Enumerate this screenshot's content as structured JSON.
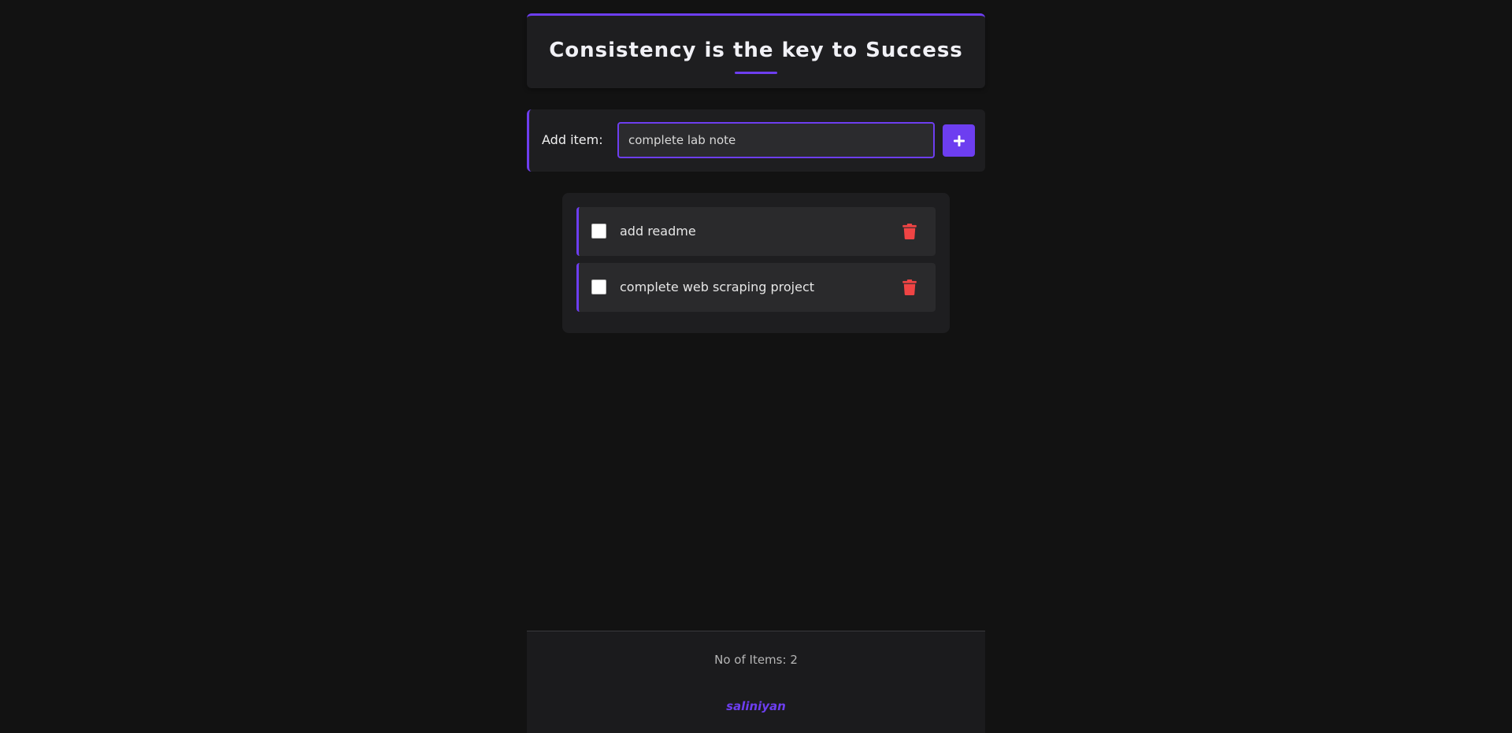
{
  "colors": {
    "background": "#121212",
    "panel": "#1e1e20",
    "accent": "#6d3ef0",
    "danger": "#ef4444"
  },
  "header": {
    "title": "Consistency is the key to Success"
  },
  "add_form": {
    "label": "Add item:",
    "input_value": "complete lab note",
    "add_button_icon": "plus-icon"
  },
  "items": [
    {
      "text": "add readme",
      "checked": false,
      "delete_icon": "trash-icon"
    },
    {
      "text": "complete web scraping project",
      "checked": false,
      "delete_icon": "trash-icon"
    }
  ],
  "footer": {
    "count_label": "No of Items:",
    "count": "2",
    "author": "saliniyan"
  }
}
